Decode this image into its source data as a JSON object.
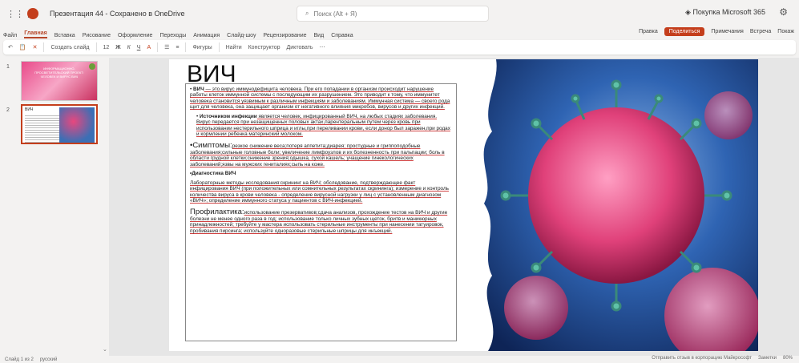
{
  "app": {
    "title": "Презентация 44 - Сохранено в OneDrive",
    "search_placeholder": "Поиск (Alt + Я)",
    "buy": "Покупка Microsoft 365"
  },
  "tabs": [
    "Файл",
    "Главная",
    "Вставка",
    "Рисование",
    "Оформление",
    "Переходы",
    "Анимация",
    "Слайд-шоу",
    "Рецензирование",
    "Вид",
    "Справка"
  ],
  "tabs_right": {
    "edit": "Правка",
    "share": "Поделиться",
    "comments": "Примечания",
    "meeting": "Встреча",
    "more": "Покаж"
  },
  "ribbon": {
    "new_slide": "Создать слайд",
    "font_size": "12",
    "shapes": "Фигуры",
    "find": "Найти",
    "designer": "Конструктор",
    "dictate": "Диктовать"
  },
  "thumbnails": [
    {
      "num": "1",
      "caption": "ИНФОРМАЦИОННО-ПРОСВЕТИТЕЛЬСКИЙ ПРОЕКТ: ЧЕЛОВЕК И ВИРУС ВИЧ"
    },
    {
      "num": "2",
      "caption": "ВИЧ"
    }
  ],
  "slide": {
    "title": "ВИЧ",
    "p1_bold": "ВИЧ",
    "p1": " — это вирус иммунодефицита человека. При его попадании в организм происходит нарушение работы клеток иммунной системы с последующим их разрушением. Это приводит к тому, что иммунитет человека становится уязвимым к различным инфекциям и заболеваниям. Иммунная система — своего рода щит для человека, она защищает организм от негативного влияния микробов, вирусов и других инфекций.",
    "p2_bold": "Источником инфекции",
    "p2": " является человек, инфицированный ВИЧ, на любых стадиях заболевания. Вирус передается при незащищенных половых актах,парентеральным путем через кровь при использовании нестерильного шприца и иглы,при переливании крови, если донор был заражен,при родах и кормлении ребенка материнский молоком.",
    "p3_head": "•Симптомы:",
    "p3": "резкое снижение веса;потеря аппетита;диарея; простудные и гриппоподобные заболевания;сильные головные боли; увеличение лимфоузлов и их болезненность при пальпации; боль в области грудной клетки;снижение зрения;одышка, сухой кашель; учащение гинекологических заболеваний;язвы на мужских гениталиях;сыпь на коже.",
    "p4_head": "•Диагностика ВИЧ",
    "p4": "Лабораторные методы исследования:скрининг на ВИЧ; обследование, подтверждающее факт инфицирования ВИЧ (при положительных или сомнительных результатах скрининга); измерение и контроль количества вируса в крови человека - определение вирусной нагрузки у лиц с установленным диагнозом «ВИЧ»; определение иммунного статуса у пациентов с ВИЧ-инфекцией.",
    "p5_head": "Профилактика:",
    "p5": "использование презервативов;сдача анализов, прохождение тестов на ВИЧ и другие болезни не менее одного раза в год; использование только личных зубных щеток, бритв и маникюрных принадлежностей; требуйте у мастера использовать стерильные инструменты при нанесении татуировок, пробивания пирсинга; используйте одноразовые стерильные шприцы для инъекций."
  },
  "status": {
    "slide_info": "Слайд 1 из 2",
    "lang": "русский",
    "feedback": "Отправить отзыв в корпорацию Майкрософт",
    "notes": "Заметки",
    "zoom": "80%"
  }
}
